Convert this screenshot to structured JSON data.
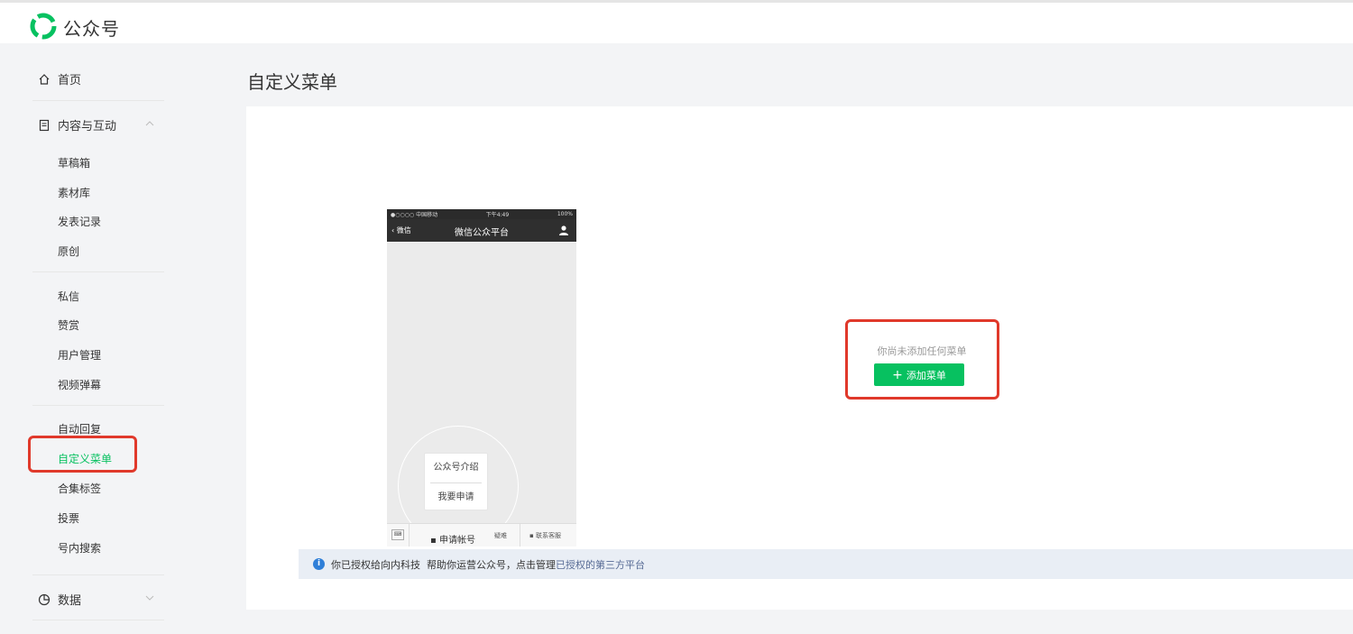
{
  "brand": {
    "name": "公众号",
    "logo_icon": "wechat-official-account-logo",
    "accent_color": "#07c160"
  },
  "sidebar": {
    "home": {
      "label": "首页",
      "icon": "home-icon"
    },
    "content_group": {
      "label": "内容与互动",
      "icon": "document-icon",
      "expanded": true
    },
    "group1": [
      "草稿箱",
      "素材库",
      "发表记录",
      "原创"
    ],
    "group2": [
      "私信",
      "赞赏",
      "用户管理",
      "视频弹幕"
    ],
    "group3": [
      "自动回复",
      "自定义菜单",
      "合集标签",
      "投票",
      "号内搜索"
    ],
    "active_item": "自定义菜单",
    "data": {
      "label": "数据",
      "icon": "pie-chart-icon",
      "expanded": false
    }
  },
  "main": {
    "title": "自定义菜单",
    "phone": {
      "carrier": "●○○○○ 中国移动",
      "time": "下午4:49",
      "battery": "100%",
      "back_label": "微信",
      "nav_title": "微信公众平台",
      "popup_items": [
        "公众号介绍",
        "我要申请"
      ],
      "bottom_apply": "申请帐号",
      "bottom_left_fragment": "疑难",
      "bottom_right": "联系客服"
    },
    "empty_state": {
      "text": "你尚未添加任何菜单",
      "add_button": "添加菜单"
    },
    "infobar": {
      "text_prefix": "你已授权给向内科技  帮助你运营公众号，点击管理",
      "link": "已授权的第三方平台"
    }
  }
}
